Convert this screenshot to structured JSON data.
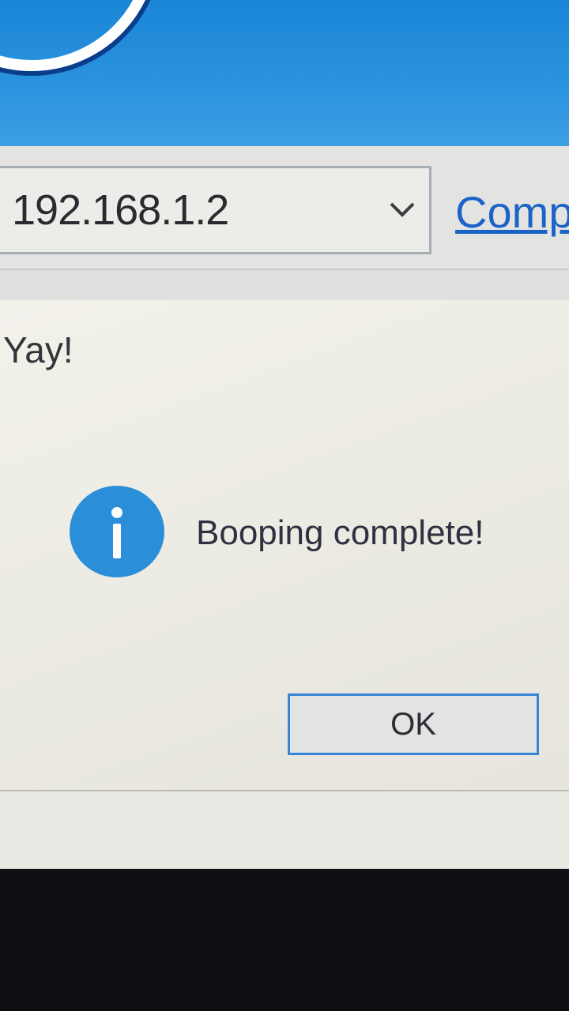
{
  "toolbar": {
    "ip_address": "192.168.1.2",
    "link_text": "Comp"
  },
  "dialog": {
    "title": "Yay!",
    "message": "Booping complete!",
    "ok_label": "OK",
    "icon": "info-icon"
  },
  "colors": {
    "accent": "#2a8fd8",
    "link": "#1c63c8",
    "banner": "#2b93e0"
  }
}
